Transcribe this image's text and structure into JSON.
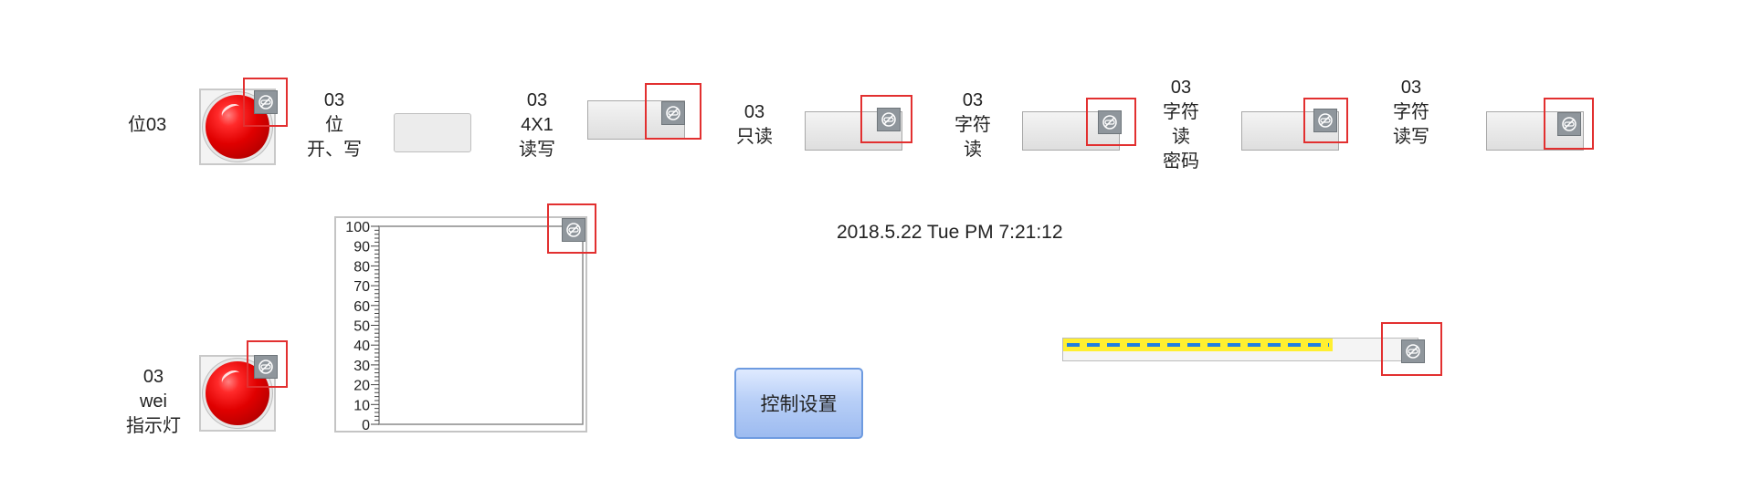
{
  "row1": {
    "lamp_label": "位03",
    "toggle_label": [
      "03",
      "位",
      "开、写"
    ],
    "field_4x1_label": [
      "03",
      "4X1",
      "读写"
    ],
    "field_readonly_label": [
      "03",
      "只读"
    ],
    "field_string_read_label": [
      "03",
      "字符",
      "读"
    ],
    "field_string_password_label": [
      "03",
      "字符",
      "读",
      "密码"
    ],
    "field_string_rw_label": [
      "03",
      "字符",
      "读写"
    ]
  },
  "chart_data": {
    "type": "line",
    "title": "",
    "xlabel": "",
    "ylabel": "",
    "ylim": [
      0,
      100
    ],
    "y_ticks": [
      "100",
      "90",
      "80",
      "70",
      "60",
      "50",
      "40",
      "30",
      "20",
      "10",
      "0"
    ],
    "series": []
  },
  "datetime": "2018.5.22 Tue PM 7:21:12",
  "lamp2_label": [
    "03",
    "wei",
    "指示灯"
  ],
  "button": {
    "label": "控制设置"
  },
  "progress": {
    "value_fraction": 0.76
  },
  "icons": {
    "control": "no-link-icon"
  },
  "colors": {
    "lamp": "#e00000",
    "highlight_frame": "#e23030",
    "progress_fill": "#ffef30",
    "progress_dash": "#1f7fe0"
  }
}
